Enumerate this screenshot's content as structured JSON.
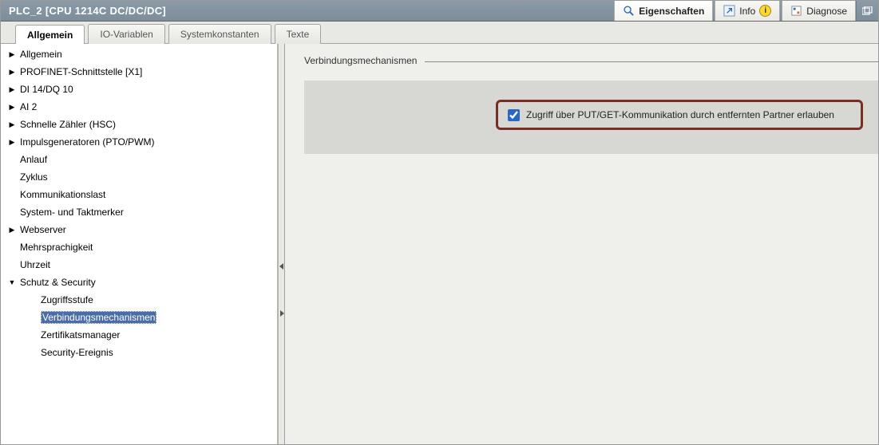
{
  "title": "PLC_2 [CPU 1214C DC/DC/DC]",
  "topbar": {
    "tabs": [
      {
        "label": "Eigenschaften",
        "active": true
      },
      {
        "label": "Info",
        "active": false
      },
      {
        "label": "Diagnose",
        "active": false
      }
    ]
  },
  "tabs": {
    "items": [
      {
        "label": "Allgemein",
        "active": true
      },
      {
        "label": "IO-Variablen",
        "active": false
      },
      {
        "label": "Systemkonstanten",
        "active": false
      },
      {
        "label": "Texte",
        "active": false
      }
    ]
  },
  "tree": {
    "items": [
      {
        "label": "Allgemein",
        "arrow": "right",
        "indent": 0
      },
      {
        "label": "PROFINET-Schnittstelle [X1]",
        "arrow": "right",
        "indent": 0
      },
      {
        "label": "DI 14/DQ 10",
        "arrow": "right",
        "indent": 0
      },
      {
        "label": "AI 2",
        "arrow": "right",
        "indent": 0
      },
      {
        "label": "Schnelle Zähler (HSC)",
        "arrow": "right",
        "indent": 0
      },
      {
        "label": "Impulsgeneratoren (PTO/PWM)",
        "arrow": "right",
        "indent": 0
      },
      {
        "label": "Anlauf",
        "arrow": "none",
        "indent": 0
      },
      {
        "label": "Zyklus",
        "arrow": "none",
        "indent": 0
      },
      {
        "label": "Kommunikationslast",
        "arrow": "none",
        "indent": 0
      },
      {
        "label": "System- und Taktmerker",
        "arrow": "none",
        "indent": 0
      },
      {
        "label": "Webserver",
        "arrow": "right",
        "indent": 0
      },
      {
        "label": "Mehrsprachigkeit",
        "arrow": "none",
        "indent": 0
      },
      {
        "label": "Uhrzeit",
        "arrow": "none",
        "indent": 0
      },
      {
        "label": "Schutz & Security",
        "arrow": "down",
        "indent": 0
      },
      {
        "label": "Zugriffsstufe",
        "arrow": "none",
        "indent": 1
      },
      {
        "label": "Verbindungsmechanismen",
        "arrow": "none",
        "indent": 1,
        "selected": true
      },
      {
        "label": "Zertifikatsmanager",
        "arrow": "none",
        "indent": 1
      },
      {
        "label": "Security-Ereignis",
        "arrow": "none",
        "indent": 1
      }
    ]
  },
  "content": {
    "section_title": "Verbindungsmechanismen",
    "checkbox_label": "Zugriff über PUT/GET-Kommunikation durch entfernten Partner erlauben",
    "checkbox_checked": true
  }
}
